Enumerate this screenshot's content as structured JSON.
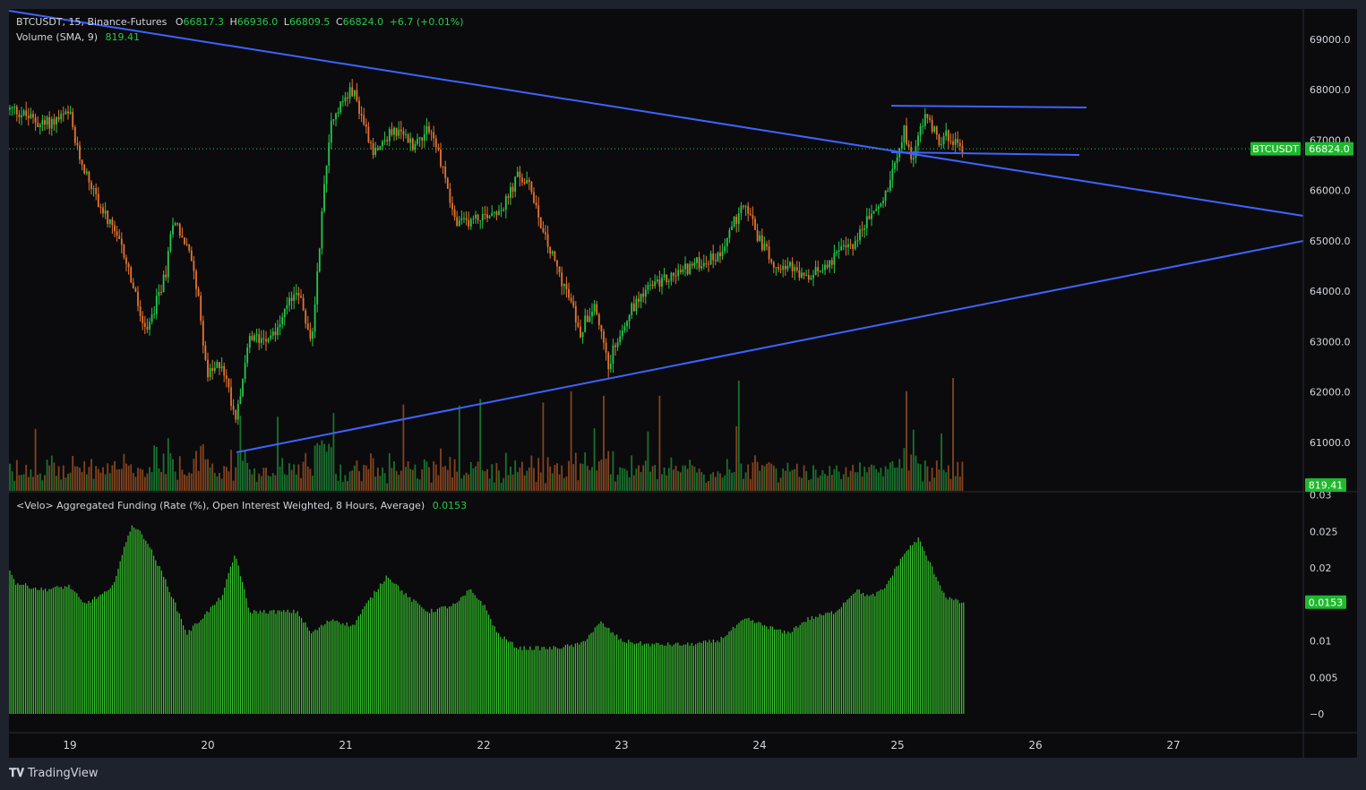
{
  "header": {
    "symbol": "BTCUSDT, 15, Binance-Futures",
    "o_label": "O",
    "o_value": "66817.3",
    "h_label": "H",
    "h_value": "66936.0",
    "l_label": "L",
    "l_value": "66809.5",
    "c_label": "C",
    "c_value": "66824.0",
    "change": "+6.7 (+0.01%)",
    "volume_label": "Volume (SMA, 9)",
    "volume_value": "819.41"
  },
  "funding_legend": {
    "label": "<Velo> Aggregated Funding (Rate (%), Open Interest Weighted, 8 Hours, Average)",
    "value": "0.0153"
  },
  "badges": {
    "symbol": "BTCUSDT",
    "price": "66824.0",
    "volume": "819.41",
    "funding": "0.0153"
  },
  "brand": "TradingView",
  "colors": {
    "up": "#26c94a",
    "down": "#e8732e",
    "trendline": "#3e63ff",
    "badge": "#1fb82e",
    "funding_bar": "#35c42c"
  },
  "chart_data": [
    {
      "type": "candlestick",
      "symbol": "BTCUSDT",
      "interval": "15",
      "x_ticks": [
        "19",
        "20",
        "21",
        "22",
        "23",
        "24",
        "25",
        "26",
        "27"
      ],
      "y_ticks": [
        "69000.0",
        "68000.0",
        "67000.0",
        "66000.0",
        "65000.0",
        "64000.0",
        "63000.0",
        "62000.0",
        "61000.0"
      ],
      "ylim": [
        60100,
        69500
      ],
      "last_price": 66824.0,
      "price_path_day_close": [
        [
          18.6,
          67600
        ],
        [
          18.8,
          67300
        ],
        [
          19.0,
          67500
        ],
        [
          19.05,
          66800
        ],
        [
          19.2,
          65800
        ],
        [
          19.4,
          64700
        ],
        [
          19.55,
          63100
        ],
        [
          19.7,
          64400
        ],
        [
          19.75,
          65500
        ],
        [
          19.9,
          64500
        ],
        [
          20.0,
          62300
        ],
        [
          20.1,
          62600
        ],
        [
          20.2,
          61500
        ],
        [
          20.3,
          63000
        ],
        [
          20.5,
          63200
        ],
        [
          20.65,
          64100
        ],
        [
          20.75,
          62900
        ],
        [
          20.85,
          66300
        ],
        [
          20.9,
          67500
        ],
        [
          21.05,
          68000
        ],
        [
          21.2,
          66800
        ],
        [
          21.35,
          67200
        ],
        [
          21.5,
          66900
        ],
        [
          21.6,
          67300
        ],
        [
          21.7,
          66500
        ],
        [
          21.8,
          65300
        ],
        [
          22.0,
          65500
        ],
        [
          22.15,
          65700
        ],
        [
          22.25,
          66300
        ],
        [
          22.35,
          66000
        ],
        [
          22.45,
          65000
        ],
        [
          22.6,
          64000
        ],
        [
          22.7,
          63200
        ],
        [
          22.8,
          63800
        ],
        [
          22.9,
          62500
        ],
        [
          23.0,
          63300
        ],
        [
          23.15,
          64000
        ],
        [
          23.3,
          64200
        ],
        [
          23.5,
          64500
        ],
        [
          23.7,
          64700
        ],
        [
          23.8,
          65300
        ],
        [
          23.9,
          65700
        ],
        [
          24.0,
          65000
        ],
        [
          24.1,
          64600
        ],
        [
          24.2,
          64500
        ],
        [
          24.35,
          64200
        ],
        [
          24.5,
          64600
        ],
        [
          24.7,
          65000
        ],
        [
          24.8,
          65500
        ],
        [
          24.9,
          65800
        ],
        [
          25.0,
          66800
        ],
        [
          25.05,
          67200
        ],
        [
          25.1,
          66600
        ],
        [
          25.2,
          67500
        ],
        [
          25.3,
          67000
        ],
        [
          25.38,
          67100
        ],
        [
          25.45,
          66824
        ]
      ]
    },
    {
      "type": "bar",
      "name": "Volume (SMA, 9)",
      "last_value": 819.41
    },
    {
      "type": "bar",
      "name": "<Velo> Aggregated Funding (Rate (%), Open Interest Weighted, 8 Hours, Average)",
      "y_ticks": [
        "0.03",
        "0.025",
        "0.02",
        "0.0153",
        "0.01",
        "0.005",
        "0"
      ],
      "ylim": [
        0,
        0.03
      ],
      "last_value": 0.0153,
      "path_day_value": [
        [
          18.45,
          0.026
        ],
        [
          18.6,
          0.018
        ],
        [
          18.8,
          0.017
        ],
        [
          19.0,
          0.0175
        ],
        [
          19.1,
          0.015
        ],
        [
          19.3,
          0.017
        ],
        [
          19.45,
          0.026
        ],
        [
          19.55,
          0.024
        ],
        [
          19.7,
          0.018
        ],
        [
          19.85,
          0.011
        ],
        [
          20.0,
          0.014
        ],
        [
          20.1,
          0.016
        ],
        [
          20.2,
          0.022
        ],
        [
          20.3,
          0.014
        ],
        [
          20.5,
          0.014
        ],
        [
          20.65,
          0.014
        ],
        [
          20.75,
          0.011
        ],
        [
          20.9,
          0.013
        ],
        [
          21.05,
          0.012
        ],
        [
          21.15,
          0.015
        ],
        [
          21.3,
          0.019
        ],
        [
          21.45,
          0.016
        ],
        [
          21.6,
          0.014
        ],
        [
          21.8,
          0.015
        ],
        [
          21.9,
          0.017
        ],
        [
          22.0,
          0.015
        ],
        [
          22.1,
          0.011
        ],
        [
          22.25,
          0.009
        ],
        [
          22.5,
          0.009
        ],
        [
          22.7,
          0.0095
        ],
        [
          22.85,
          0.0125
        ],
        [
          23.0,
          0.01
        ],
        [
          23.2,
          0.0095
        ],
        [
          23.5,
          0.0095
        ],
        [
          23.7,
          0.01
        ],
        [
          23.9,
          0.013
        ],
        [
          24.05,
          0.012
        ],
        [
          24.2,
          0.011
        ],
        [
          24.35,
          0.013
        ],
        [
          24.55,
          0.014
        ],
        [
          24.7,
          0.017
        ],
        [
          24.8,
          0.016
        ],
        [
          24.9,
          0.017
        ],
        [
          25.05,
          0.022
        ],
        [
          25.15,
          0.024
        ],
        [
          25.25,
          0.02
        ],
        [
          25.35,
          0.016
        ],
        [
          25.45,
          0.0153
        ]
      ]
    }
  ]
}
